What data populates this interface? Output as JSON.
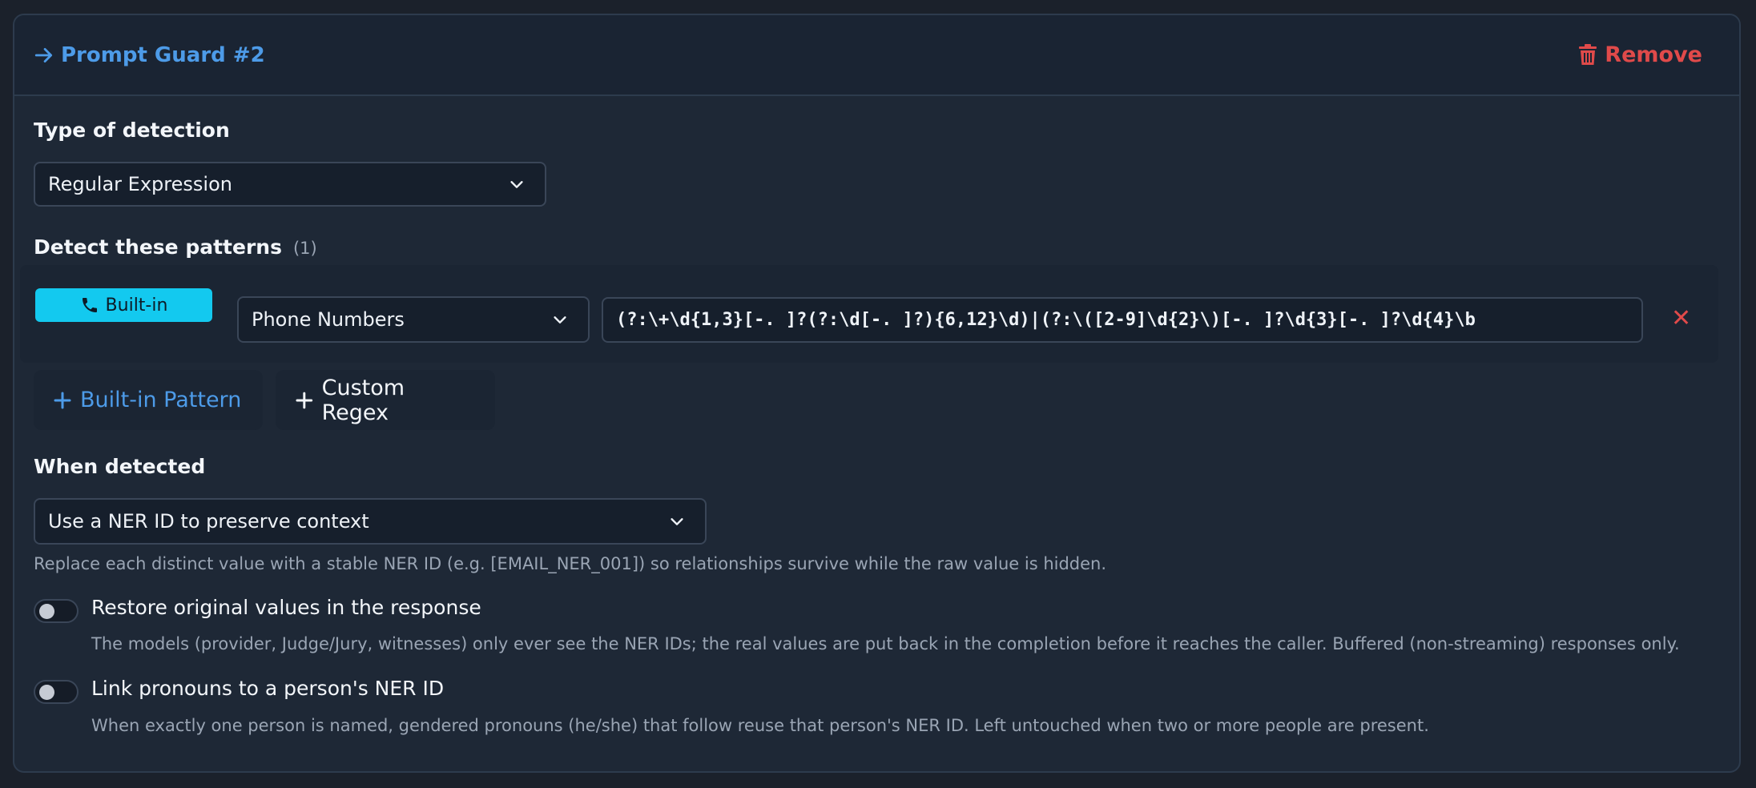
{
  "header": {
    "title": "Prompt Guard #2",
    "remove_label": "Remove"
  },
  "detection": {
    "label": "Type of detection",
    "selected": "Regular Expression"
  },
  "patterns": {
    "label": "Detect these patterns",
    "count": "(1)",
    "items": [
      {
        "badge": "Built-in",
        "type": "Phone Numbers",
        "regex": "(?:\\+\\d{1,3}[-. ]?(?:\\d[-. ]?){6,12}\\d)|(?:\\([2-9]\\d{2}\\)[-. ]?\\d{3}[-. ]?\\d{4}\\b"
      }
    ],
    "add_builtin_label": "Built-in Pattern",
    "add_custom_label": "Custom Regex"
  },
  "when_detected": {
    "label": "When detected",
    "selected": "Use a NER ID to preserve context",
    "helper": "Replace each distinct value with a stable NER ID (e.g. [EMAIL_NER_001]) so relationships survive while the raw value is hidden."
  },
  "toggles": [
    {
      "label": "Restore original values in the response",
      "helper": "The models (provider, Judge/Jury, witnesses) only ever see the NER IDs; the real values are put back in the completion before it reaches the caller. Buffered (non-streaming) responses only.",
      "on": false
    },
    {
      "label": "Link pronouns to a person's NER ID",
      "helper": "When exactly one person is named, gendered pronouns (he/she) that follow reuse that person's NER ID. Left untouched when two or more people are present.",
      "on": false
    }
  ],
  "colors": {
    "accent": "#4d9be8",
    "danger": "#e04a4a",
    "badge": "#13c9ef"
  }
}
